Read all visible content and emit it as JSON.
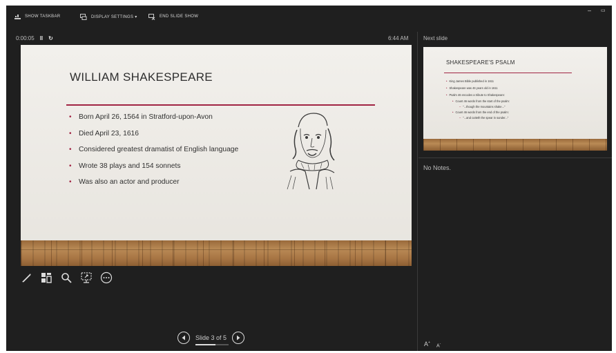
{
  "toolbar": {
    "show_taskbar": "SHOW TASKBAR",
    "display_settings": "DISPLAY SETTINGS ▾",
    "end_slide_show": "END SLIDE SHOW",
    "minimize_glyph": "–",
    "restore_glyph": "▭"
  },
  "timer": {
    "elapsed": "0:00:05",
    "pause_glyph": "II",
    "restart_glyph": "↻"
  },
  "clock": "6:44 AM",
  "next_slide_label": "Next slide",
  "current_slide": {
    "title": "WILLIAM SHAKESPEARE",
    "bullets": [
      "Born April 26, 1564 in Stratford-upon-Avon",
      "Died April 23, 1616",
      "Considered greatest dramatist of English language",
      "Wrote 38 plays and 154 sonnets",
      "Was also an actor and producer"
    ],
    "bullet_glyph": "•",
    "accent_color": "#a02343"
  },
  "next_slide": {
    "title": "SHAKESPEARE'S PSALM",
    "bullets": [
      "King James Bible published in 1611",
      "Shakespeare was 46 years old in 1611",
      "Psalm 46 encodes a tribute to Shakespeare:",
      "Count 46 words from the start of the psalm:",
      "\"...though the mountains shake...\"",
      "Count 46 words from the end of the psalm:",
      "\"...and cutteth the spear in sunder...\""
    ]
  },
  "notes": "No Notes.",
  "tools": [
    "pen-icon",
    "slide-sorter-icon",
    "zoom-icon",
    "pointer-screen-icon",
    "more-options-icon"
  ],
  "navigation": {
    "counter": "Slide 3 of 5",
    "current": 3,
    "total": 5
  },
  "font_controls": {
    "increase": "A",
    "decrease": "A"
  }
}
